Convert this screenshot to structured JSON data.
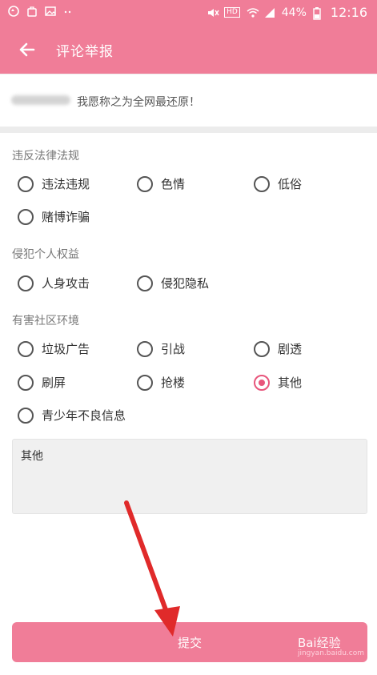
{
  "status_bar": {
    "battery": "44%",
    "time": "12:16",
    "hd": "HD"
  },
  "app_bar": {
    "title": "评论举报"
  },
  "comment": {
    "text": "我愿称之为全网最还原！"
  },
  "sections": [
    {
      "label": "违反法律法规",
      "options": [
        {
          "label": "违法违规",
          "checked": false
        },
        {
          "label": "色情",
          "checked": false
        },
        {
          "label": "低俗",
          "checked": false
        },
        {
          "label": "赌博诈骗",
          "checked": false
        }
      ]
    },
    {
      "label": "侵犯个人权益",
      "options": [
        {
          "label": "人身攻击",
          "checked": false
        },
        {
          "label": "侵犯隐私",
          "checked": false
        }
      ]
    },
    {
      "label": "有害社区环境",
      "options": [
        {
          "label": "垃圾广告",
          "checked": false
        },
        {
          "label": "引战",
          "checked": false
        },
        {
          "label": "剧透",
          "checked": false
        },
        {
          "label": "刷屏",
          "checked": false
        },
        {
          "label": "抢楼",
          "checked": false
        },
        {
          "label": "其他",
          "checked": true
        },
        {
          "label": "青少年不良信息",
          "checked": false
        }
      ]
    }
  ],
  "textarea": {
    "value": "其他"
  },
  "submit": {
    "label": "提交"
  },
  "watermark": {
    "brand": "Bai经验",
    "url": "jingyan.baidu.com"
  },
  "colors": {
    "accent": "#f07d98",
    "checked": "#e8567c",
    "annotation_arrow": "#e02a2a"
  }
}
